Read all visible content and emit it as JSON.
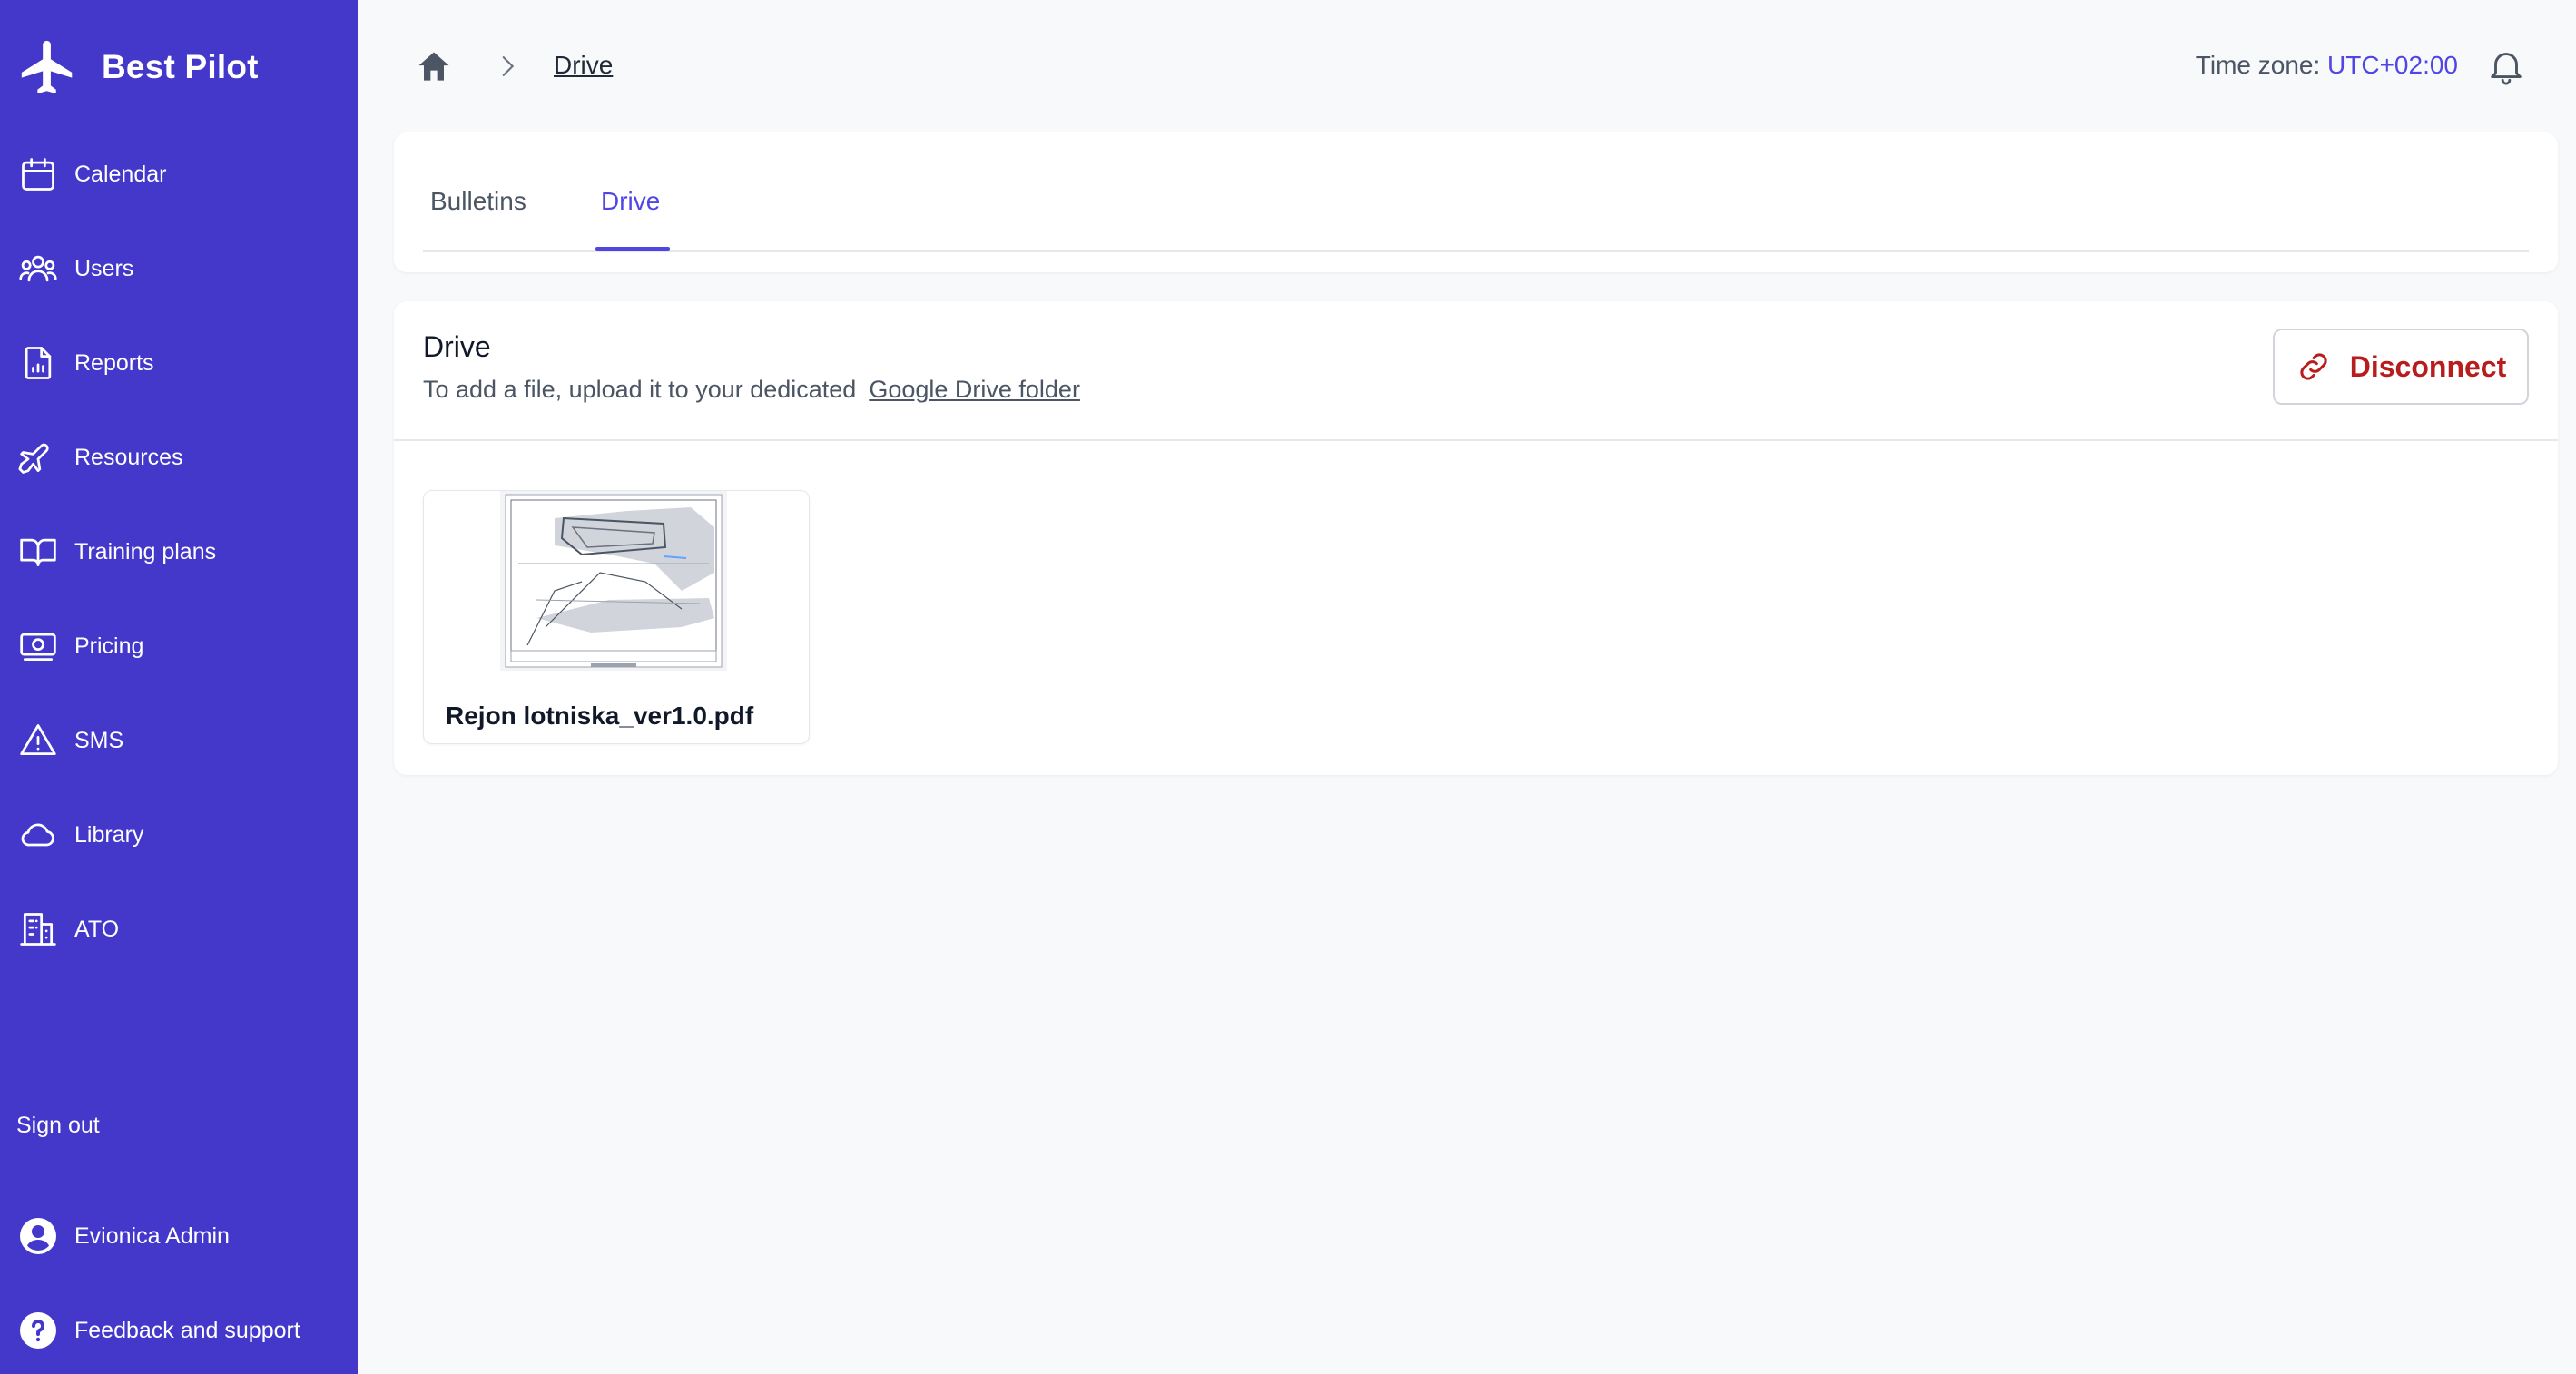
{
  "app": {
    "name": "Best Pilot"
  },
  "colors": {
    "sidebar_bg": "#4338ca",
    "accent": "#4f46e5",
    "danger": "#b91c1c"
  },
  "sidebar": {
    "items": [
      {
        "label": "Calendar",
        "icon": "calendar-icon"
      },
      {
        "label": "Users",
        "icon": "users-icon"
      },
      {
        "label": "Reports",
        "icon": "report-icon"
      },
      {
        "label": "Resources",
        "icon": "airplane-icon"
      },
      {
        "label": "Training plans",
        "icon": "book-icon"
      },
      {
        "label": "Pricing",
        "icon": "money-icon"
      },
      {
        "label": "SMS",
        "icon": "warning-icon"
      },
      {
        "label": "Library",
        "icon": "cloud-icon"
      },
      {
        "label": "ATO",
        "icon": "building-icon"
      }
    ],
    "sign_out": "Sign out",
    "user_name": "Evionica Admin",
    "support": "Feedback and support"
  },
  "header": {
    "breadcrumb_current": "Drive",
    "timezone_label": "Time zone:",
    "timezone_value": "UTC+02:00"
  },
  "tabs": [
    {
      "label": "Bulletins",
      "active": false
    },
    {
      "label": "Drive",
      "active": true
    }
  ],
  "drive": {
    "title": "Drive",
    "subtitle": "To add a file, upload it to your dedicated",
    "link_text": "Google Drive folder",
    "disconnect_label": "Disconnect",
    "files": [
      {
        "name": "Rejon lotniska_ver1.0.pdf"
      }
    ]
  }
}
